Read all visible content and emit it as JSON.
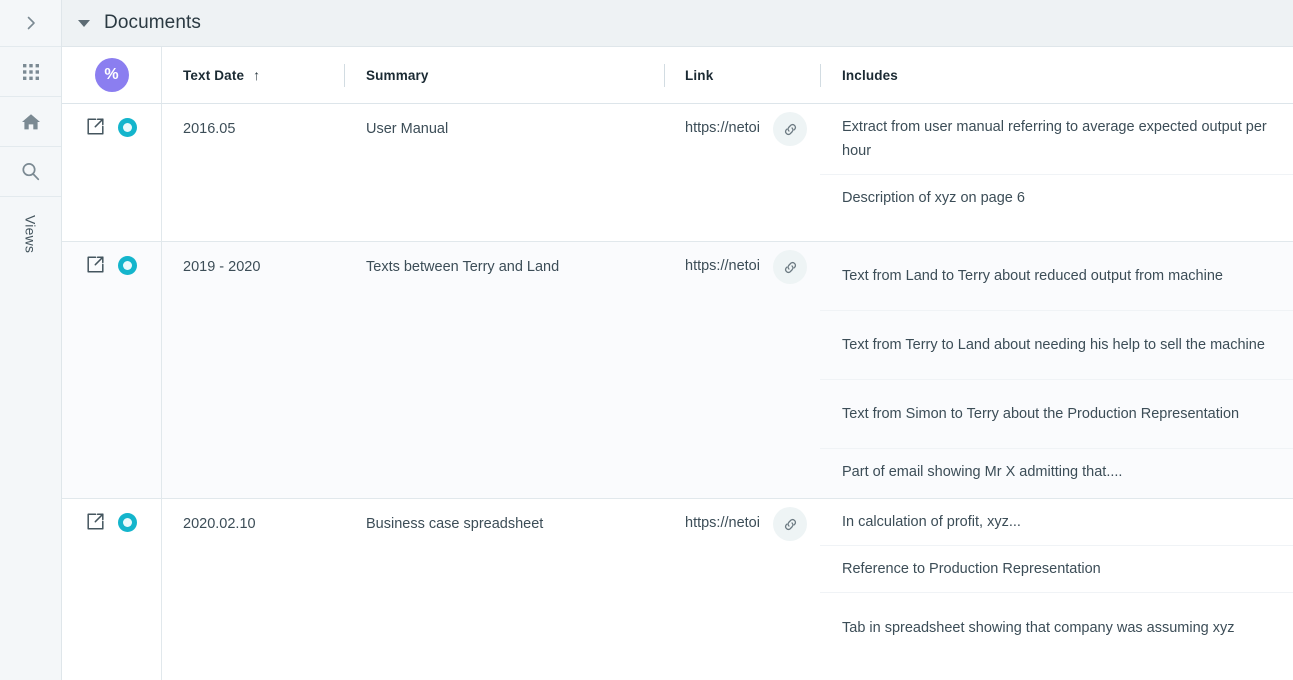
{
  "sidebar": {
    "items": [
      {
        "name": "expand",
        "icon": "chevron-right-icon",
        "label": ""
      },
      {
        "name": "apps",
        "icon": "grid-apps-icon",
        "label": ""
      },
      {
        "name": "home",
        "icon": "home-icon",
        "label": ""
      },
      {
        "name": "search",
        "icon": "search-icon",
        "label": ""
      }
    ],
    "views_label": "Views"
  },
  "section": {
    "title": "Documents",
    "collapse_icon": "caret-down-icon"
  },
  "table": {
    "header": {
      "badge_icon": "percent-icon",
      "badge_label": "%",
      "columns": [
        {
          "label": "Text Date",
          "sorted": true,
          "sort_arrow": "↑"
        },
        {
          "label": "Summary",
          "sorted": false,
          "sort_arrow": ""
        },
        {
          "label": "Link",
          "sorted": false,
          "sort_arrow": ""
        },
        {
          "label": "Includes",
          "sorted": false,
          "sort_arrow": ""
        }
      ]
    },
    "rows": [
      {
        "open_icon": "external-link-icon",
        "status_icon": "donut-circle-icon",
        "text_date": "2016.05",
        "summary": "User Manual",
        "link_text": "https://netoi",
        "link_icon": "link-chain-icon",
        "includes": [
          "Extract from user manual referring to average expected output per hour",
          "Description of xyz on page 6"
        ]
      },
      {
        "open_icon": "external-link-icon",
        "status_icon": "donut-circle-icon",
        "text_date": "2019 - 2020",
        "summary": "Texts between Terry and Land",
        "link_text": "https://netoi",
        "link_icon": "link-chain-icon",
        "includes": [
          "Text from Land to Terry about reduced output from machine",
          "Text from Terry to Land about needing his help to sell the machine",
          "Text from Simon to Terry about the Production Representation",
          "Part of email showing Mr X admitting that...."
        ]
      },
      {
        "open_icon": "external-link-icon",
        "status_icon": "donut-circle-icon",
        "text_date": "2020.02.10",
        "summary": "Business case spreadsheet",
        "link_text": "https://netoi",
        "link_icon": "link-chain-icon",
        "includes": [
          "In calculation of profit, xyz...",
          "Reference to Production Representation",
          "Tab in spreadsheet showing that company was assuming xyz"
        ]
      }
    ]
  },
  "colors": {
    "badge_purple": "#8b7ef0",
    "status_teal": "#14b5cc",
    "header_bg": "#eef2f4",
    "rail_bg": "#f4f7f9",
    "text": "#3c4d57"
  }
}
